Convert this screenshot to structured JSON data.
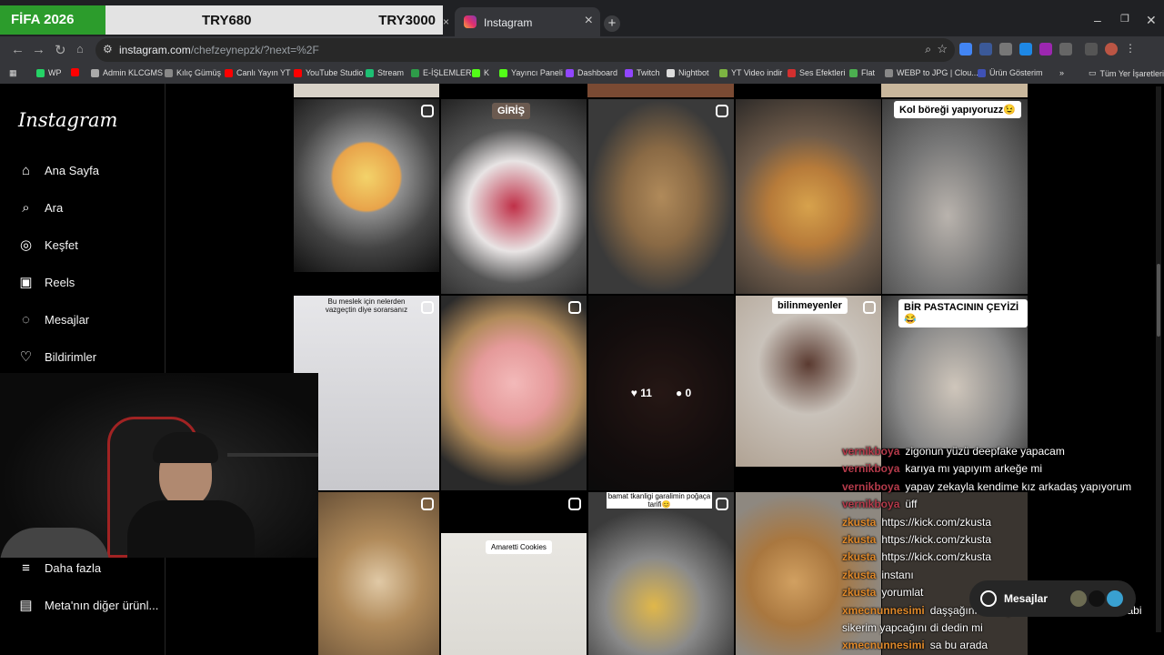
{
  "overlay_banner": {
    "brand": "FİFA 2026",
    "price_a": "TRY680",
    "price_b": "TRY3000"
  },
  "browser": {
    "tab_title": "Instagram",
    "url_domain": "instagram.com",
    "url_path": "/chefzeynepzk/?next=%2F",
    "bookmarks": [
      {
        "label": "WP",
        "color": "#25d366"
      },
      {
        "label": "",
        "color": "#ff0000"
      },
      {
        "label": "Admin KLCGMS",
        "color": "#aaaaaa"
      },
      {
        "label": "Kılıç Gümüş",
        "color": "#888888"
      },
      {
        "label": "Canlı Yayın YT",
        "color": "#ff0000"
      },
      {
        "label": "YouTube Studio",
        "color": "#ff0000"
      },
      {
        "label": "Stream",
        "color": "#1dbf73"
      },
      {
        "label": "E-İŞLEMLER",
        "color": "#2e9c49"
      },
      {
        "label": "K",
        "color": "#53fc18"
      },
      {
        "label": "Yayıncı Paneli",
        "color": "#53fc18"
      },
      {
        "label": "Dashboard",
        "color": "#9146ff"
      },
      {
        "label": "Twitch",
        "color": "#9146ff"
      },
      {
        "label": "Nightbot",
        "color": "#dddddd"
      },
      {
        "label": "YT Video indir",
        "color": "#7cb342"
      },
      {
        "label": "Ses Efektleri",
        "color": "#d32f2f"
      },
      {
        "label": "Flat",
        "color": "#4caf50"
      },
      {
        "label": "WEBP to JPG | Clou...",
        "color": "#888888"
      },
      {
        "label": "Ürün Gösterim",
        "color": "#3f51b5"
      }
    ],
    "more_bookmarks": "»",
    "all_bookmarks": "Tüm Yer İşaretleri"
  },
  "sidebar": {
    "logo": "Instagram",
    "items": [
      {
        "label": "Ana Sayfa",
        "icon": "home-icon"
      },
      {
        "label": "Ara",
        "icon": "search-icon"
      },
      {
        "label": "Keşfet",
        "icon": "compass-icon"
      },
      {
        "label": "Reels",
        "icon": "reels-icon"
      },
      {
        "label": "Mesajlar",
        "icon": "messenger-icon"
      },
      {
        "label": "Bildirimler",
        "icon": "heart-icon"
      }
    ],
    "more": "Daha fazla",
    "meta": "Meta'nın diğer ürünl..."
  },
  "grid": {
    "captions": {
      "giris": "GİRİŞ",
      "kol": "Kol böreği yapıyoruzz😉",
      "meslek": "Bu meslek için nelerden vazgeçtin diye sorarsanız",
      "bilinmeyen": "bilinmeyenler",
      "pastacinin": "BİR PASTACININ ÇEYİZİ😂",
      "amaretti": "Amaretti Cookies",
      "bamat": "bamat tkanligi garalimin poğaça tarifi😊"
    },
    "hover": {
      "likes": "11",
      "comments": "0"
    }
  },
  "chat": [
    {
      "user": "vernikboya",
      "text": "zigonun yüzü deepfake yapacam",
      "color": "#b43a4a"
    },
    {
      "user": "vernikboya",
      "text": "karıya mı yapıyım arkeğe mi",
      "color": "#b43a4a"
    },
    {
      "user": "vernikboya",
      "text": "yapay zekayla kendime kız arkadaş yapıyorum",
      "color": "#b43a4a"
    },
    {
      "user": "vernikboya",
      "text": "üff",
      "color": "#b43a4a"
    },
    {
      "user": "zkusta",
      "text": "https://kick.com/zkusta",
      "color": "#e0892a"
    },
    {
      "user": "zkusta",
      "text": "https://kick.com/zkusta",
      "color": "#e0892a"
    },
    {
      "user": "zkusta",
      "text": "https://kick.com/zkusta",
      "color": "#e0892a"
    },
    {
      "user": "zkusta",
      "text": "instanı",
      "color": "#e0892a"
    },
    {
      "user": "zkusta",
      "text": "yorumlat",
      "color": "#e0892a"
    },
    {
      "user": "xmecnunnesimi",
      "text": "daşşağını masaya vurdun mu toplantıda abi sikerim yapcağını di dedin mi",
      "color": "#e0892a"
    },
    {
      "user": "xmecnunnesimi",
      "text": "sa bu arada",
      "color": "#e0892a"
    }
  ],
  "messages_pill": "Mesajlar"
}
